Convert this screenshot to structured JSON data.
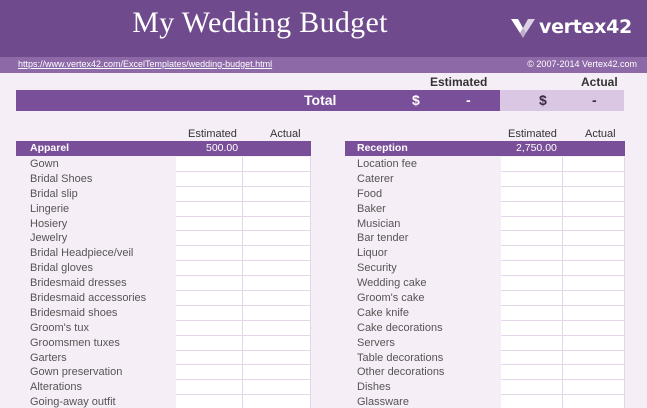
{
  "header": {
    "title": "My Wedding Budget",
    "brand": "vertex42",
    "url": "https://www.vertex42.com/ExcelTemplates/wedding-budget.html",
    "copyright": "© 2007-2014 Vertex42.com"
  },
  "summary": {
    "estimated_label": "Estimated",
    "actual_label": "Actual",
    "total_label": "Total",
    "currency": "$",
    "estimated_total": "-",
    "actual_total": "-"
  },
  "colors": {
    "header": "#6f4a8c",
    "urlbar": "#8e69a8",
    "accent": "#7a4f99",
    "actual_bg": "#d9c7e4",
    "page_bg": "#f6eef6"
  },
  "left": {
    "estimated_label": "Estimated",
    "actual_label": "Actual",
    "category": "Apparel",
    "category_estimated": "500.00",
    "items": [
      "Gown",
      "Bridal Shoes",
      "Bridal slip",
      "Lingerie",
      "Hosiery",
      "Jewelry",
      "Bridal Headpiece/veil",
      "Bridal gloves",
      "Bridesmaid dresses",
      "Bridesmaid accessories",
      "Bridesmaid shoes",
      "Groom's tux",
      "Groomsmen tuxes",
      "Garters",
      "Gown preservation",
      "Alterations",
      "Going-away outfit"
    ]
  },
  "right": {
    "estimated_label": "Estimated",
    "actual_label": "Actual",
    "category": "Reception",
    "category_estimated": "2,750.00",
    "items": [
      "Location fee",
      "Caterer",
      "Food",
      "Baker",
      "Musician",
      "Bar tender",
      "Liquor",
      "Security",
      "Wedding cake",
      "Groom's cake",
      "Cake knife",
      "Cake decorations",
      "Servers",
      "Table decorations",
      "Other decorations",
      "Dishes",
      "Glassware"
    ]
  }
}
